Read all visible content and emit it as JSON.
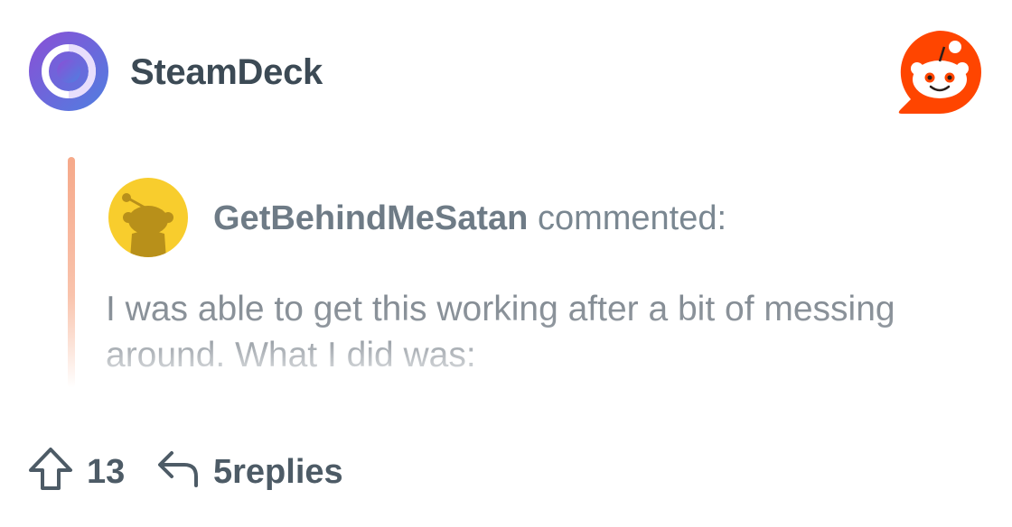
{
  "subreddit": {
    "name": "SteamDeck",
    "icon": "steamdeck-logo-icon"
  },
  "app": {
    "logo": "reddit-logo-icon",
    "brand_color": "#ff4500"
  },
  "comment": {
    "author": "GetBehindMeSatan",
    "action": "commented:",
    "avatar_icon": "snoo-avatar-icon",
    "text": "I was able to get this working after a bit of messing around. What I did was:",
    "accent_color": "#f6a98a"
  },
  "footer": {
    "upvote_icon": "upvote-arrow-icon",
    "votes": "13",
    "reply_icon": "reply-arrow-icon",
    "replies": "5replies"
  }
}
